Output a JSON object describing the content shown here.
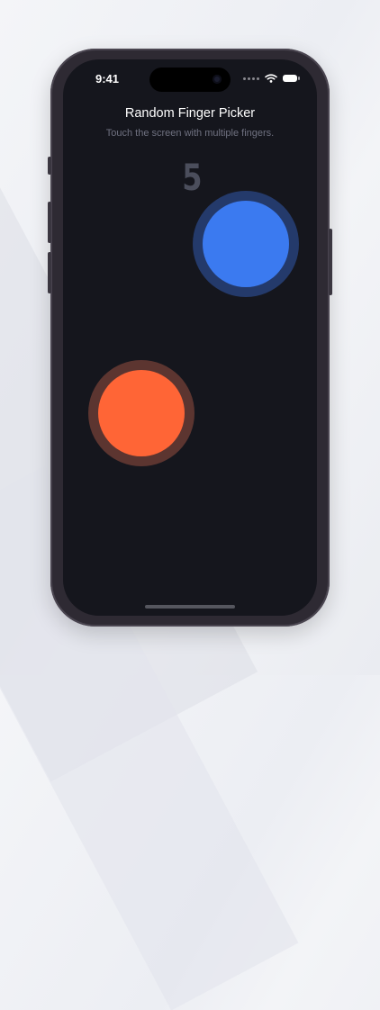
{
  "status_bar": {
    "time": "9:41",
    "icons": [
      "signal-dots-icon",
      "wifi-icon",
      "battery-icon"
    ]
  },
  "app": {
    "title": "Random Finger Picker",
    "subtitle": "Touch the screen with multiple fingers.",
    "countdown": "5"
  },
  "fingers": [
    {
      "name": "finger-circle-blue",
      "color": "#3b7af0",
      "ring_color": "#243a6b"
    },
    {
      "name": "finger-circle-orange",
      "color": "#ff6536",
      "ring_color": "#5c3530"
    }
  ],
  "colors": {
    "screen_background": "#15161d",
    "title": "#ffffff",
    "subtitle": "#6f7180",
    "countdown": "#4b4e5c"
  }
}
